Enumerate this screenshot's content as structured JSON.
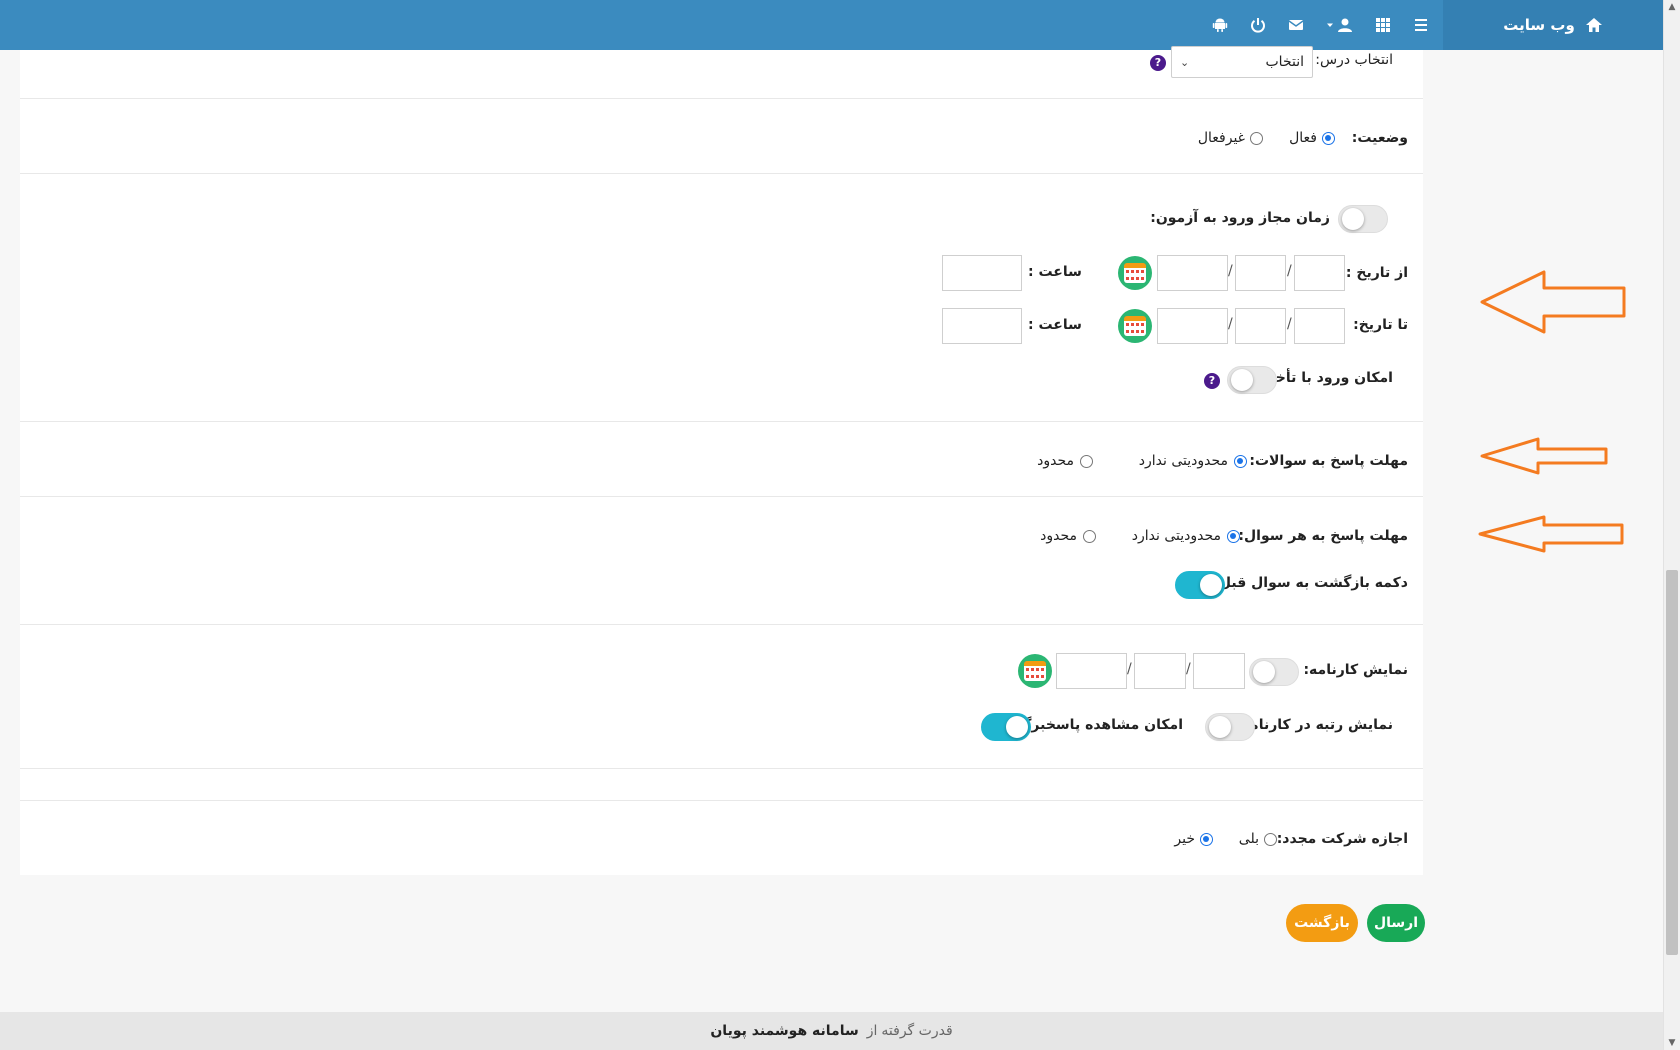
{
  "topbar": {
    "brand_label": "وب سایت",
    "icons": [
      "home-icon",
      "menu-icon",
      "grid-icon",
      "user-icon",
      "caret-down-icon",
      "mail-icon",
      "power-icon",
      "android-icon"
    ]
  },
  "form": {
    "course": {
      "label": "انتخاب درس:",
      "selected": "انتخاب"
    },
    "status": {
      "label": "وضعیت:",
      "options": [
        "فعال",
        "غیرفعال"
      ],
      "selected": "فعال"
    },
    "entry_time": {
      "label": "زمان مجاز ورود به آزمون:",
      "enabled": false,
      "from_label": "از تاریخ :",
      "to_label": "تا تاریخ:",
      "time_label": "ساعت :",
      "separator": "/",
      "late_entry_label": "امکان ورود با تأخیر",
      "late_entry_enabled": false
    },
    "answer_deadline": {
      "label": "مهلت پاسخ به سوالات:",
      "options": [
        "محدودیتی ندارد",
        "محدود"
      ],
      "selected": "محدودیتی ندارد"
    },
    "per_question_deadline": {
      "label": "مهلت پاسخ به هر سوال:",
      "options": [
        "محدودیتی ندارد",
        "محدود"
      ],
      "selected": "محدودیتی ندارد"
    },
    "back_button": {
      "label": "دکمه بازگشت به سوال قبل",
      "enabled": true
    },
    "report_card": {
      "label": "نمایش کارنامه:",
      "enabled": false
    },
    "rank_in_report": {
      "label": "نمایش رتبه در کارنامه:",
      "enabled": false
    },
    "answer_sheet_view": {
      "label": "امکان مشاهده پاسخبرگ:",
      "enabled": true
    },
    "retake": {
      "label": "اجازه شرکت مجدد:",
      "options": [
        "بلی",
        "خیر"
      ],
      "selected": "خیر"
    },
    "help_glyph": "?"
  },
  "actions": {
    "submit_label": "ارسال",
    "back_label": "بازگشت"
  },
  "footer": {
    "prefix": "قدرت گرفته",
    "by": "از",
    "brand": "سامانه هوشمند پویان"
  },
  "colors": {
    "topbar": "#3b8bbf",
    "brand_bg": "#3480b3",
    "accent_radio": "#1a73e8",
    "toggle_on": "#1fb6d0",
    "submit": "#18a957",
    "back": "#f39c12",
    "annotation_arrow": "#f47b20"
  }
}
